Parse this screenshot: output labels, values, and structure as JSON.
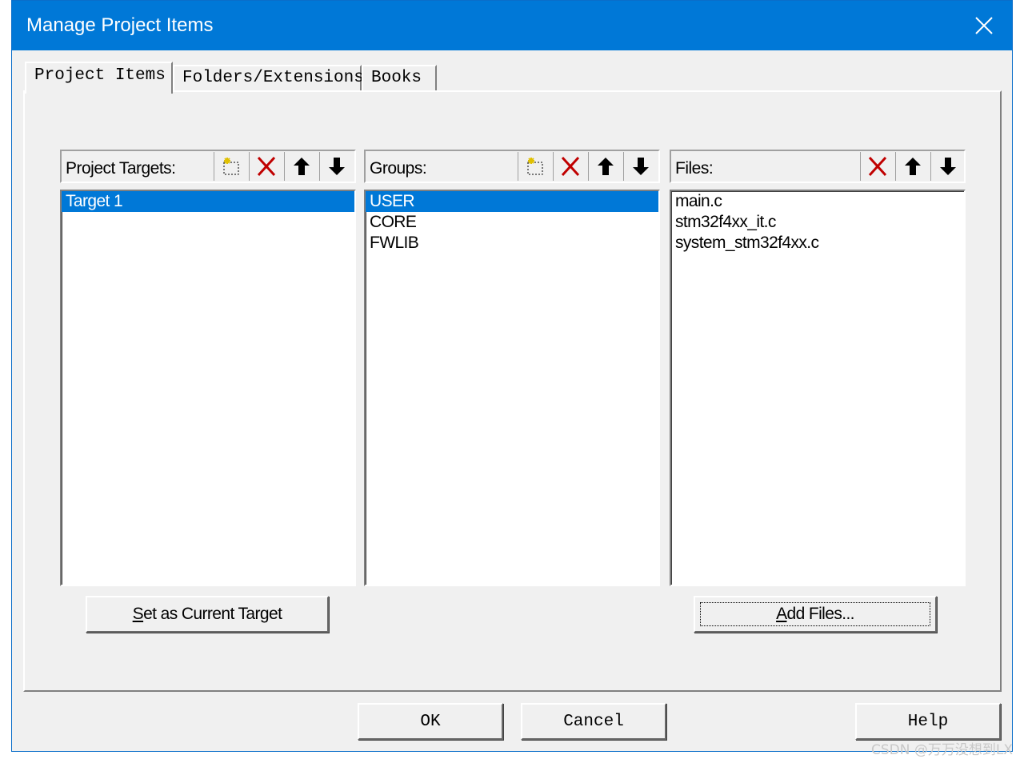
{
  "window": {
    "title": "Manage Project Items",
    "close_icon": "close-icon"
  },
  "tabs": [
    {
      "label": "Project Items",
      "active": true
    },
    {
      "label": "Folders/Extensions",
      "active": false
    },
    {
      "label": "Books",
      "active": false
    }
  ],
  "targets": {
    "header": "Project Targets:",
    "items": [
      "Target 1"
    ],
    "selected_index": 0,
    "toolbar": [
      "new-icon",
      "delete-icon",
      "move-up-icon",
      "move-down-icon"
    ]
  },
  "groups": {
    "header": "Groups:",
    "items": [
      "USER",
      "CORE",
      "FWLIB"
    ],
    "selected_index": 0,
    "toolbar": [
      "new-icon",
      "delete-icon",
      "move-up-icon",
      "move-down-icon"
    ]
  },
  "files": {
    "header": "Files:",
    "items": [
      "main.c",
      "stm32f4xx_it.c",
      "system_stm32f4xx.c"
    ],
    "toolbar": [
      "delete-icon",
      "move-up-icon",
      "move-down-icon"
    ]
  },
  "buttons": {
    "set_current": {
      "mnemonic": "S",
      "rest": "et as Current Target"
    },
    "add_files": {
      "mnemonic": "A",
      "rest": "dd Files..."
    },
    "ok": "OK",
    "cancel": "Cancel",
    "help": "Help"
  },
  "watermark": "CSDN @万万没想到LX",
  "colors": {
    "titlebar": "#0078d7",
    "selection": "#0078d7",
    "delete_x": "#c00000"
  }
}
